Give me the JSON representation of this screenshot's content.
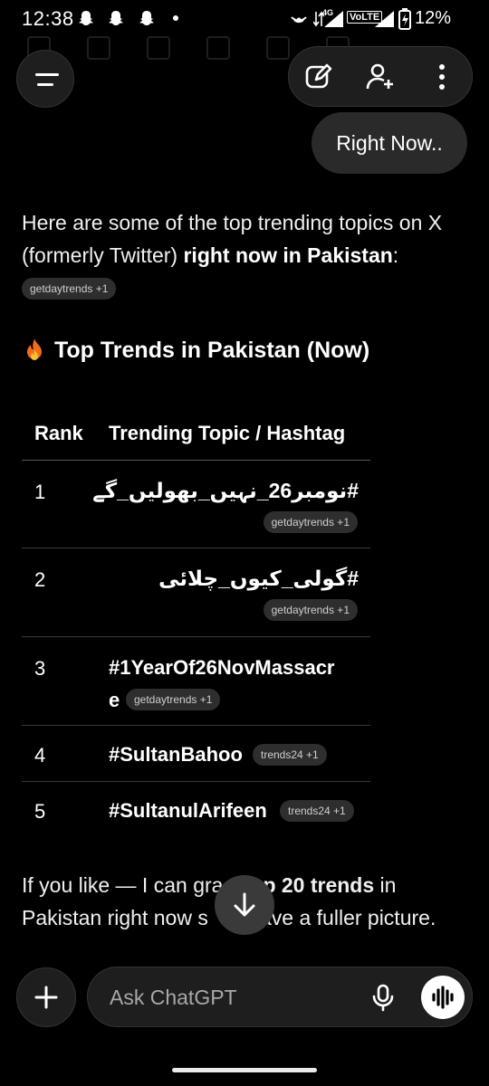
{
  "status_bar": {
    "time": "12:38",
    "network": "4G",
    "volte": "VoLTE",
    "battery": "12%"
  },
  "user_message": "Right Now..",
  "intro": {
    "text_a": "Here are some of the top trending topics on X (formerly Twitter) ",
    "text_bold": "right now in Pakistan",
    "text_b": ":",
    "chip": "getdaytrends +1"
  },
  "heading": "Top Trends in Pakistan (Now)",
  "table": {
    "headers": [
      "Rank",
      "Trending Topic / Hashtag"
    ],
    "rows": [
      {
        "rank": "1",
        "topic": "#نومبر26_نہیں_بھولیں_گے",
        "source": "getdaytrends +1"
      },
      {
        "rank": "2",
        "topic": "#گولی_کیوں_چلائی",
        "source": "getdaytrends +1"
      },
      {
        "rank": "3",
        "topic_line1": "#1YearOf26NovMassacr",
        "topic_line2": "e",
        "source": "getdaytrends +1"
      },
      {
        "rank": "4",
        "topic": "#SultanBahoo",
        "source": "trends24 +1"
      },
      {
        "rank": "5",
        "topic": "#SultanulArifeen",
        "source": "trends24 +1"
      }
    ]
  },
  "outro": {
    "text_a": "If you like — I can gra",
    "text_bold": "p 20 trends",
    "text_b": " in Pakistan right now s",
    "text_c": " have a fuller picture."
  },
  "composer": {
    "placeholder": "Ask ChatGPT"
  },
  "colors": {
    "background": "#000000",
    "surface": "#1e1e1e",
    "chip": "#2e2e2e"
  }
}
